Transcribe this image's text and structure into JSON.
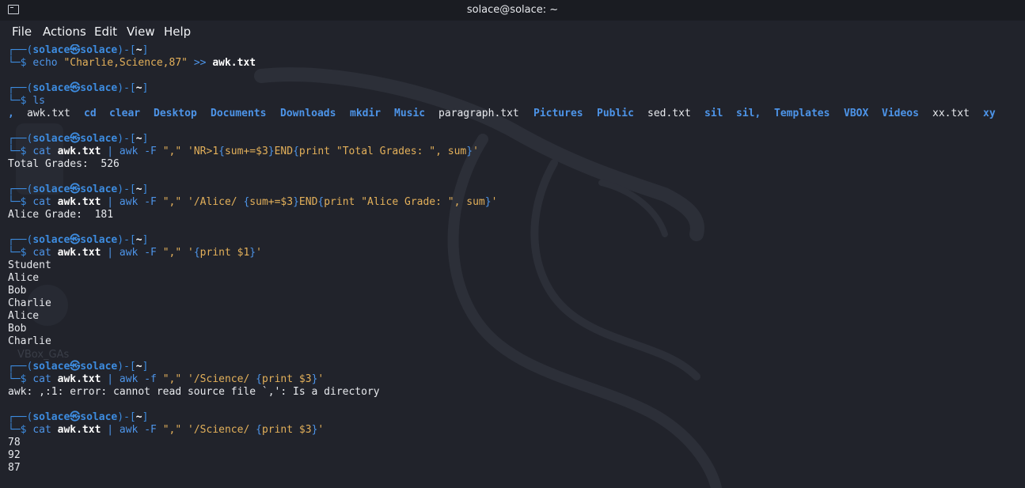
{
  "window": {
    "title": "solace@solace: ~"
  },
  "menu": [
    "File",
    "Actions",
    "Edit",
    "View",
    "Help"
  ],
  "prompt": {
    "user": "solace",
    "host": "solace",
    "dir": "~",
    "at_symbol": "㉿"
  },
  "commands": {
    "c1": {
      "cmd": "echo",
      "arg": "\"Charlie,Science,87\"",
      "op": ">>",
      "file": "awk.txt"
    },
    "c2": {
      "cmd": "ls"
    },
    "c3": {
      "cmd": "cat",
      "file": "awk.txt",
      "pipe": "| awk -F",
      "sep": "\",\"",
      "q1": "'NR>1",
      "b1": "{",
      "body1": "sum+=$3",
      "b2": "}",
      "end": "END",
      "b3": "{",
      "print_kw": "print",
      "print_str": "\"Total Grades: \"",
      "tail": ", sum",
      "b4": "}",
      "q2": "'"
    },
    "c4": {
      "cmd": "cat",
      "file": "awk.txt",
      "pipe": "| awk -F",
      "sep": "\",\"",
      "pat": "'/Alice/ ",
      "b1": "{",
      "body1": "sum+=$3",
      "b2": "}",
      "end": "END",
      "b3": "{",
      "print_kw": "print",
      "print_str": "\"Alice Grade: \"",
      "tail": ", sum",
      "b4": "}",
      "q2": "'"
    },
    "c5": {
      "cmd": "cat",
      "file": "awk.txt",
      "pipe": "| awk -F",
      "sep": "\",\"",
      "q1": "'",
      "b1": "{",
      "body": "print $1",
      "b2": "}",
      "q2": "'"
    },
    "c6": {
      "cmd": "cat",
      "file": "awk.txt",
      "pipe": "| awk -f",
      "sep": "\",\"",
      "pat": "'/Science/ ",
      "b1": "{",
      "body": "print $3",
      "b2": "}",
      "q2": "'"
    },
    "c7": {
      "cmd": "cat",
      "file": "awk.txt",
      "pipe": "| awk -F",
      "sep": "\",\"",
      "pat": "'/Science/ ",
      "b1": "{",
      "body": "print $3",
      "b2": "}",
      "q2": "'"
    }
  },
  "ls_output": [
    {
      "name": ",",
      "dir": true
    },
    {
      "name": "awk.txt",
      "dir": false
    },
    {
      "name": "cd",
      "dir": true
    },
    {
      "name": "clear",
      "dir": true
    },
    {
      "name": "Desktop",
      "dir": true
    },
    {
      "name": "Documents",
      "dir": true
    },
    {
      "name": "Downloads",
      "dir": true
    },
    {
      "name": "mkdir",
      "dir": true
    },
    {
      "name": "Music",
      "dir": true
    },
    {
      "name": "paragraph.txt",
      "dir": false
    },
    {
      "name": "Pictures",
      "dir": true
    },
    {
      "name": "Public",
      "dir": true
    },
    {
      "name": "sed.txt",
      "dir": false
    },
    {
      "name": "sil",
      "dir": true
    },
    {
      "name": "sil,",
      "dir": true
    },
    {
      "name": "Templates",
      "dir": true
    },
    {
      "name": "VBOX",
      "dir": true
    },
    {
      "name": "Videos",
      "dir": true
    },
    {
      "name": "xx.txt",
      "dir": false
    },
    {
      "name": "xy",
      "dir": true
    }
  ],
  "outputs": {
    "total_grades": "Total Grades:  526",
    "alice_grade": "Alice Grade:  181",
    "students": [
      "Student",
      "Alice",
      "Bob",
      "Charlie",
      "Alice",
      "Bob",
      "Charlie"
    ],
    "awk_error": "awk: ,:1: error: cannot read source file `,': Is a directory",
    "science_grades": [
      "78",
      "92",
      "87"
    ]
  },
  "desktop_ghost_label": "VBox_GAs",
  "colors": {
    "background": "#21232b",
    "prompt": "#3d8ce0",
    "string": "#e3b05a",
    "directory": "#4d94e8",
    "text": "#e8eaee"
  }
}
